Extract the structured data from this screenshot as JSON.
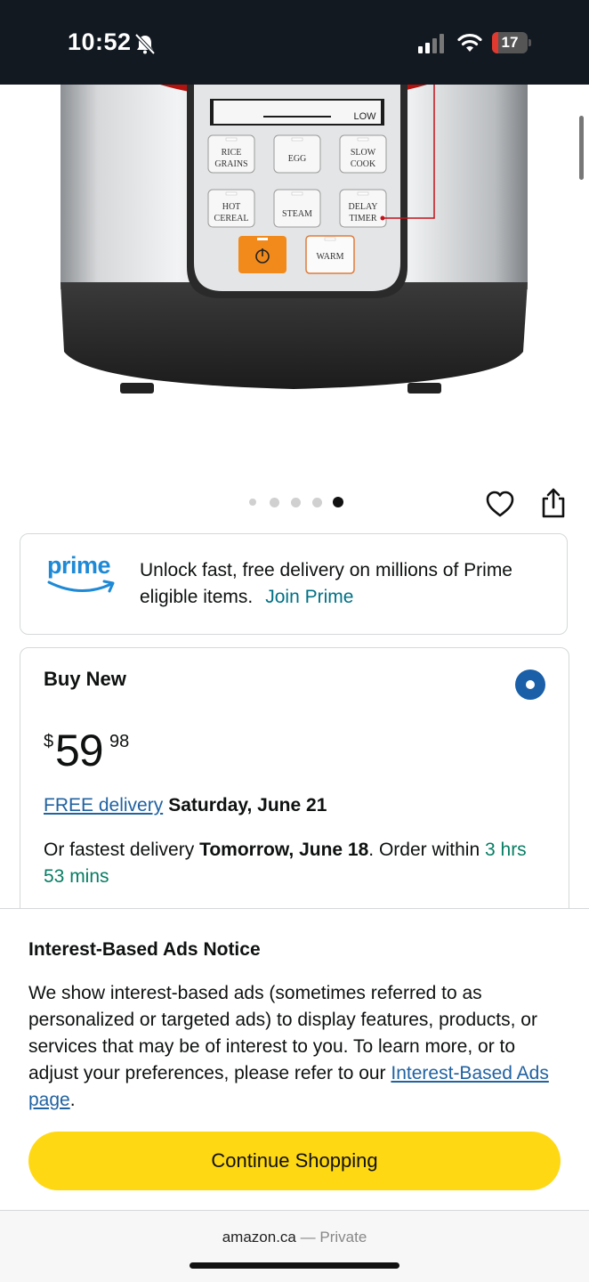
{
  "status_bar": {
    "time": "10:52",
    "battery": "17",
    "battery_level": 0.17
  },
  "product_image": {
    "display_top": "LOW",
    "buttons": [
      {
        "line1": "RICE",
        "line2": "GRAINS"
      },
      {
        "line1": "EGG",
        "line2": ""
      },
      {
        "line1": "SLOW",
        "line2": "COOK"
      },
      {
        "line1": "HOT",
        "line2": "CEREAL"
      },
      {
        "line1": "STEAM",
        "line2": ""
      },
      {
        "line1": "DELAY",
        "line2": "TIMER"
      }
    ],
    "warm_label": "WARM"
  },
  "carousel": {
    "count": 5,
    "active": 5
  },
  "prime": {
    "logo_text": "prime",
    "message": "Unlock fast, free delivery on millions of Prime eligible items.",
    "join_label": "Join Prime"
  },
  "buy_box": {
    "title": "Buy New",
    "price_symbol": "$",
    "price_whole": "59",
    "price_fraction": "98",
    "free_delivery_link": "FREE delivery",
    "free_delivery_date": "Saturday, June 21",
    "fastest_prefix": "Or fastest delivery",
    "fastest_date": "Tomorrow, June 18",
    "order_within_prefix": ". Order within",
    "order_within_time": "3 hrs 53 mins"
  },
  "ads_notice": {
    "title": "Interest-Based Ads Notice",
    "body": "We show interest-based ads (sometimes referred to as personalized or targeted ads) to display features, products, or services that may be of interest to you. To learn more, or to adjust your preferences, please refer to our",
    "link_label": "Interest-Based Ads page",
    "end": ".",
    "continue_label": "Continue Shopping"
  },
  "browser": {
    "domain": "amazon.ca",
    "separator": "—",
    "mode": "Private"
  },
  "colors": {
    "accent_yellow": "#ffd814",
    "link": "#2162a1",
    "teal": "#007185",
    "green": "#067d62",
    "prime_blue": "#1e8ad6",
    "header": "#131921"
  }
}
